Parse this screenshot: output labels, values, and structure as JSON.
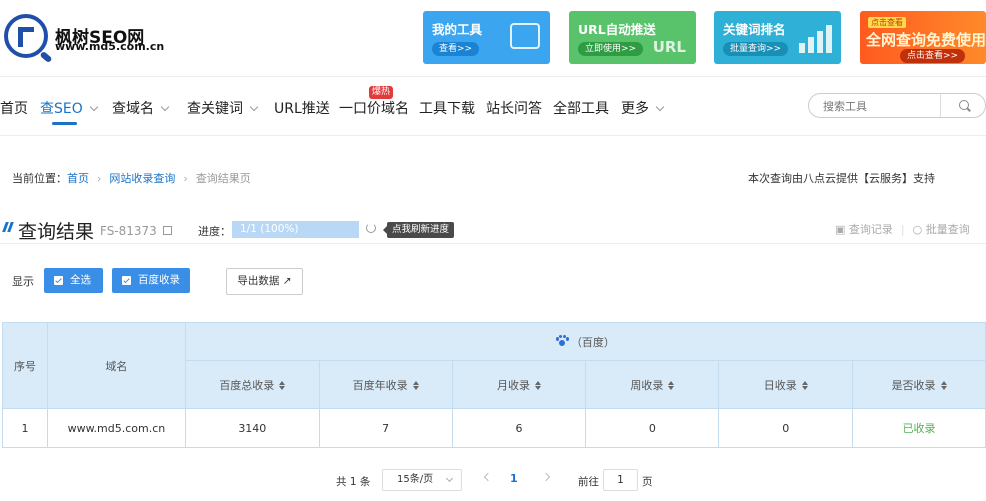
{
  "logo": {
    "name": "枫树SEO网",
    "url": "www.md5.com.cn"
  },
  "promos": [
    {
      "title": "我的工具",
      "button": "查看>>"
    },
    {
      "title": "URL自动推送",
      "button": "立即使用>>",
      "mark": "URL"
    },
    {
      "title": "关键词排名",
      "button": "批量查询>>"
    },
    {
      "tag": "点击查看",
      "title": "全网查询免费使用",
      "button": "点击查看>>"
    }
  ],
  "nav": {
    "items": [
      "首页",
      "查SEO",
      "查域名",
      "查关键词",
      "URL推送",
      "一口价域名",
      "工具下载",
      "站长问答",
      "全部工具",
      "更多"
    ],
    "hot_badge": "爆热",
    "search_placeholder": "搜索工具"
  },
  "breadcrumb": {
    "label": "当前位置：",
    "items": [
      "首页",
      "网站收录查询",
      "查询结果页"
    ],
    "support": "本次查询由八点云提供【云服务】支持"
  },
  "result": {
    "title": "查询结果",
    "code": "FS-81373",
    "progress_label": "进度：",
    "progress_text": "1/1 (100%)",
    "progress_value": 1.0,
    "refresh_tip": "点我刷新进度",
    "history": "查询记录",
    "batch": "批量查询"
  },
  "filters": {
    "show_label": "显示",
    "select_all": "全选",
    "baidu": "百度收录",
    "export": "导出数据"
  },
  "table": {
    "h_index": "序号",
    "h_domain": "域名",
    "h_group": "（百度）",
    "columns": [
      "百度总收录",
      "百度年收录",
      "月收录",
      "周收录",
      "日收录",
      "是否收录"
    ],
    "rows": [
      {
        "index": "1",
        "domain": "www.md5.com.cn",
        "total": "3140",
        "year": "7",
        "month": "6",
        "week": "0",
        "day": "0",
        "status": "已收录"
      }
    ]
  },
  "pagination": {
    "total": "共 1 条",
    "per_page": "15条/页",
    "current": "1",
    "goto_label": "前往",
    "goto_value": "1",
    "page_unit": "页"
  },
  "colors": {
    "accent": "#1a73c8",
    "button": "#3a8ee6",
    "table_header": "#d9ebf9",
    "success": "#52b152"
  }
}
